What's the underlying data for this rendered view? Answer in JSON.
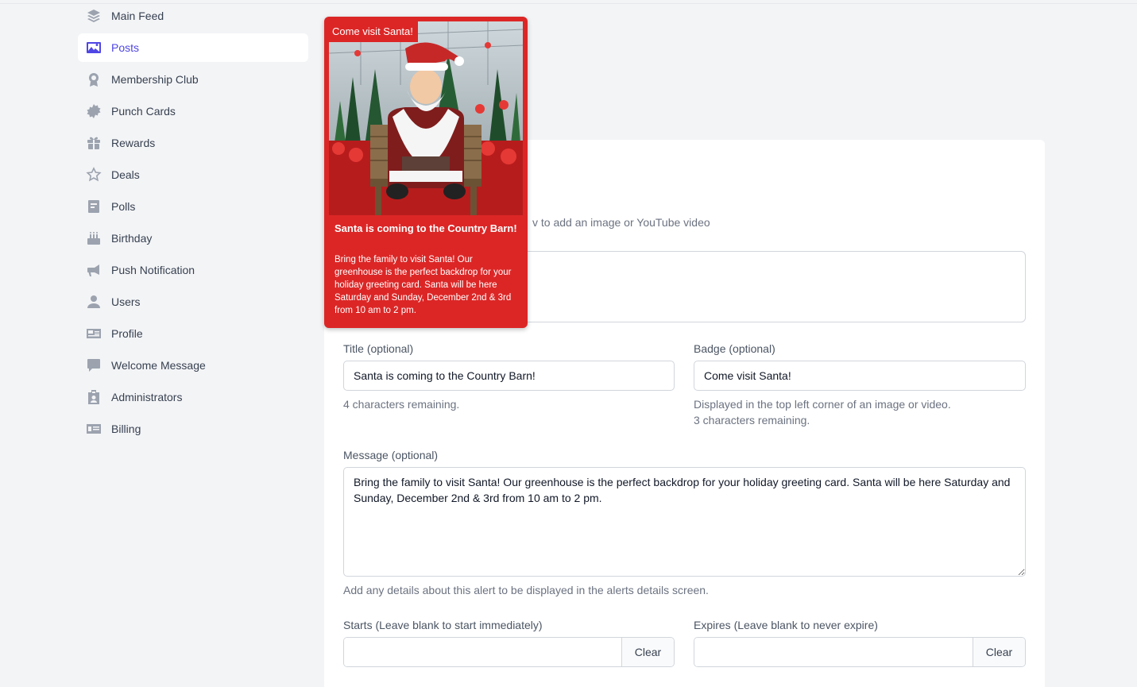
{
  "sidebar": {
    "items": [
      {
        "label": "Main Feed",
        "icon": "layers-icon"
      },
      {
        "label": "Posts",
        "icon": "image-icon",
        "active": true
      },
      {
        "label": "Membership Club",
        "icon": "award-icon"
      },
      {
        "label": "Punch Cards",
        "icon": "badge-icon"
      },
      {
        "label": "Rewards",
        "icon": "gift-icon"
      },
      {
        "label": "Deals",
        "icon": "star-icon"
      },
      {
        "label": "Polls",
        "icon": "poll-icon"
      },
      {
        "label": "Birthday",
        "icon": "cake-icon"
      },
      {
        "label": "Push Notification",
        "icon": "megaphone-icon"
      },
      {
        "label": "Users",
        "icon": "user-icon"
      },
      {
        "label": "Profile",
        "icon": "id-card-icon"
      },
      {
        "label": "Welcome Message",
        "icon": "chat-icon"
      },
      {
        "label": "Administrators",
        "icon": "badge-id-icon"
      },
      {
        "label": "Billing",
        "icon": "billing-icon"
      }
    ]
  },
  "preview": {
    "badge": "Come visit Santa!",
    "title": "Santa is coming to the Country Barn!",
    "message": "Bring the family to visit Santa! Our greenhouse is the perfect backdrop for your holiday greeting card. Santa will be here Saturday and Sunday, December 2nd & 3rd from 10 am to 2 pm."
  },
  "form": {
    "media_hint": "v to add an image or YouTube video",
    "title_label": "Title (optional)",
    "title_value": "Santa is coming to the Country Barn!",
    "title_help": "4 characters remaining.",
    "badge_label": "Badge (optional)",
    "badge_value": "Come visit Santa!",
    "badge_help_1": "Displayed in the top left corner of an image or video.",
    "badge_help_2": "3 characters remaining.",
    "message_label": "Message (optional)",
    "message_value": "Bring the family to visit Santa! Our greenhouse is the perfect backdrop for your holiday greeting card. Santa will be here Saturday and Sunday, December 2nd & 3rd from 10 am to 2 pm.",
    "message_help": "Add any details about this alert to be displayed in the alerts details screen.",
    "starts_label": "Starts (Leave blank to start immediately)",
    "expires_label": "Expires (Leave blank to never expire)",
    "clear_label": "Clear"
  },
  "colors": {
    "accent": "#4f46e5",
    "preview_bg": "#dc2626"
  }
}
